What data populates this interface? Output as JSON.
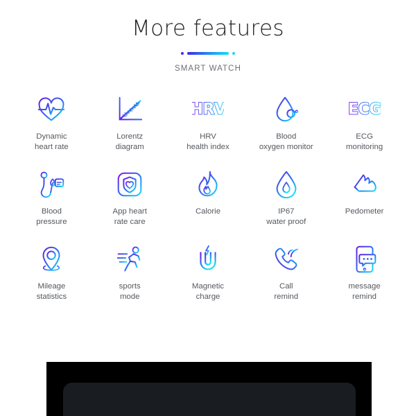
{
  "header": {
    "title": "More features",
    "subtitle": "SMART WATCH",
    "divider": {
      "left_dot_color": "#4a29e8",
      "right_dot_color": "#17d8f5",
      "bar_gradient_from": "#3b2fe8",
      "bar_gradient_to": "#16dcf7"
    }
  },
  "theme": {
    "background": "#ffffff",
    "title_color": "#1f2024",
    "label_color": "#55585e",
    "subtitle_color": "#6d7076",
    "icon_gradient_from": "#6a1de4",
    "icon_gradient_mid": "#2f6cf0",
    "icon_gradient_to": "#18dcf8",
    "panel_black": "#000000",
    "panel_screen": "#191c20"
  },
  "features": [
    {
      "icon": "heartbeat-icon",
      "label": "Dynamic\nheart rate"
    },
    {
      "icon": "scatter-plot-icon",
      "label": "Lorentz\ndiagram"
    },
    {
      "icon": "hrv-text-icon",
      "label": "HRV\nhealth index",
      "glyph": "HRV"
    },
    {
      "icon": "blood-oxygen-drop-icon",
      "label": "Blood\noxygen monitor"
    },
    {
      "icon": "ecg-text-icon",
      "label": "ECG\nmonitoring",
      "glyph": "ECG"
    },
    {
      "icon": "blood-pressure-icon",
      "label": "Blood\npressure"
    },
    {
      "icon": "shield-heart-icon",
      "label": "App heart\nrate care"
    },
    {
      "icon": "flame-icon",
      "label": "Calorie"
    },
    {
      "icon": "water-drop-icon",
      "label": "IP67\nwater proof"
    },
    {
      "icon": "sneaker-icon",
      "label": "Pedometer"
    },
    {
      "icon": "map-pin-icon",
      "label": "Mileage\nstatistics"
    },
    {
      "icon": "running-person-icon",
      "label": "sports\nmode"
    },
    {
      "icon": "magnet-icon",
      "label": "Magnetic\ncharge"
    },
    {
      "icon": "phone-ring-icon",
      "label": "Call\nremind"
    },
    {
      "icon": "message-phone-icon",
      "label": "message\nremind"
    }
  ]
}
